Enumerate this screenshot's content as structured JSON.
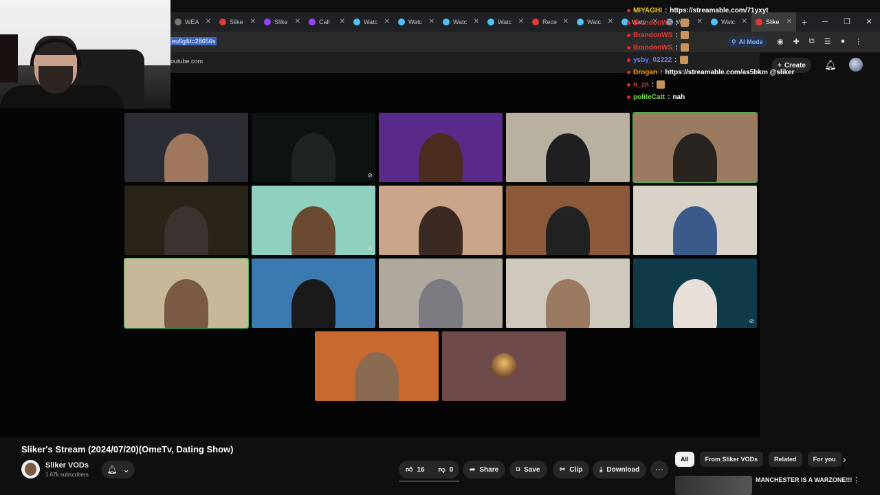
{
  "browser": {
    "tabs": [
      {
        "label": "WEA",
        "color": "#777777"
      },
      {
        "label": "Slike",
        "color": "#e53935"
      },
      {
        "label": "Slike",
        "color": "#9146ff"
      },
      {
        "label": "Call",
        "color": "#9146ff"
      },
      {
        "label": "Watc",
        "color": "#4fc3f7"
      },
      {
        "label": "Watc",
        "color": "#4fc3f7"
      },
      {
        "label": "Watc",
        "color": "#4fc3f7"
      },
      {
        "label": "Watc",
        "color": "#4fc3f7"
      },
      {
        "label": "Rece",
        "color": "#e53935"
      },
      {
        "label": "Watc",
        "color": "#4fc3f7"
      },
      {
        "label": "Watc",
        "color": "#4fc3f7"
      },
      {
        "label": "Watc",
        "color": "#4fc3f7"
      },
      {
        "label": "Watc",
        "color": "#4fc3f7"
      },
      {
        "label": "Slike",
        "color": "#e53935",
        "active": true
      }
    ],
    "url_fragment": "eu6g&t=28656s",
    "subdomain_text": "outube.com",
    "ai_mode_label": "AI Mode"
  },
  "youtube_header": {
    "create_label": "Create"
  },
  "chat": [
    {
      "user": "MIYAGHI",
      "user_color": "#f7d21e",
      "text": "https://streamable.com/71yxyt",
      "emote": false
    },
    {
      "user": "BrandonWS",
      "user_color": "#e53935",
      "text": "",
      "emote": true
    },
    {
      "user": "BrandonWS",
      "user_color": "#e53935",
      "text": "",
      "emote": true
    },
    {
      "user": "BrandonWS",
      "user_color": "#e53935",
      "text": "",
      "emote": true
    },
    {
      "user": "ysby_02222",
      "user_color": "#6a7bff",
      "text": "",
      "emote": true
    },
    {
      "user": "Drogan",
      "user_color": "#ff9800",
      "text": "https://streamable.com/as5bkm @sliker",
      "emote": false
    },
    {
      "user": "n_zn",
      "user_color": "#e53935",
      "text": "",
      "emote": true
    },
    {
      "user": "politeCatt",
      "user_color": "#7ddc4a",
      "text": "nah",
      "emote": false
    }
  ],
  "video": {
    "title": "Sliker's Stream (2024/07/20)(OmeTv, Dating Show)",
    "channel": "Sliker VODs",
    "subscribers": "1.67k subscribers",
    "likes": "16",
    "dislikes": "0",
    "share_label": "Share",
    "save_label": "Save",
    "clip_label": "Clip",
    "download_label": "Download"
  },
  "chips": [
    "All",
    "From Sliker VODs",
    "Related",
    "For you"
  ],
  "recommendation": {
    "title": "MANCHESTER IS A WARZONE!!!"
  },
  "grid_tiles": [
    {
      "bg": "#2a2d33",
      "fig": "#a07860",
      "muted": false,
      "selected": false
    },
    {
      "bg": "#0d1212",
      "fig": "#1e2424",
      "muted": true,
      "selected": false
    },
    {
      "bg": "#5a2a8a",
      "fig": "#4a2c20",
      "muted": false,
      "selected": false
    },
    {
      "bg": "#b9b1a0",
      "fig": "#1f1f22",
      "muted": false,
      "selected": false
    },
    {
      "bg": "#9a7a60",
      "fig": "#2a2420",
      "muted": false,
      "selected": true
    },
    {
      "bg": "#2a2418",
      "fig": "#3a3330",
      "muted": false,
      "selected": false
    },
    {
      "bg": "#8fd0c0",
      "fig": "#6a4a30",
      "muted": true,
      "selected": false
    },
    {
      "bg": "#caa58a",
      "fig": "#3a2a22",
      "muted": false,
      "selected": false
    },
    {
      "bg": "#8a5a3a",
      "fig": "#222222",
      "muted": false,
      "selected": false
    },
    {
      "bg": "#d8d2c8",
      "fig": "#3a5a8a",
      "muted": false,
      "selected": false
    },
    {
      "bg": "#c8b89a",
      "fig": "#7a5a44",
      "muted": false,
      "selected": true
    },
    {
      "bg": "#3a7ab0",
      "fig": "#1a1a1a",
      "muted": false,
      "selected": false
    },
    {
      "bg": "#b0a89c",
      "fig": "#7a7a80",
      "muted": false,
      "selected": false
    },
    {
      "bg": "#cfc8bc",
      "fig": "#9a7a60",
      "muted": false,
      "selected": false
    },
    {
      "bg": "#0f3a4a",
      "fig": "#e8e0d8",
      "muted": true,
      "selected": false
    },
    {
      "bg": "#c86a30",
      "fig": "#8a6a50",
      "muted": false,
      "selected": false
    },
    {
      "bg": "#6e4a4a",
      "fig": "",
      "muted": false,
      "selected": false,
      "avatar": true
    }
  ]
}
